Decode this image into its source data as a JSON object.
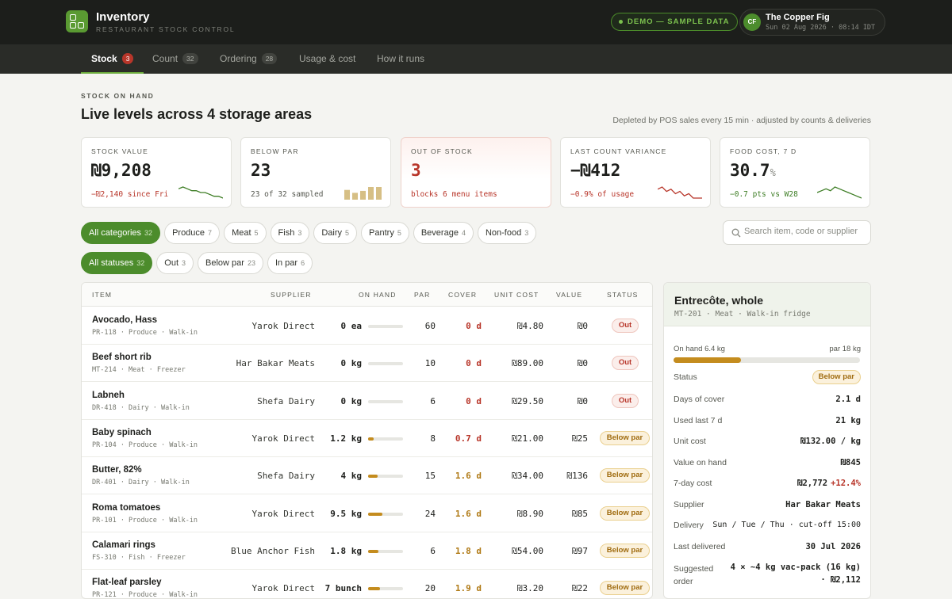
{
  "app": {
    "title": "Inventory",
    "subtitle": "RESTAURANT STOCK CONTROL",
    "demo_label": "DEMO — SAMPLE DATA",
    "venue_initials": "CF",
    "venue_name": "The Copper Fig",
    "venue_time": "Sun 02 Aug 2026 · 08:14 IDT",
    "logo_icon": "grid-logo-icon"
  },
  "tabs": [
    {
      "label": "Stock",
      "count": "3",
      "active": true
    },
    {
      "label": "Count",
      "count": "32"
    },
    {
      "label": "Ordering",
      "count": "28"
    },
    {
      "label": "Usage & cost",
      "count": ""
    },
    {
      "label": "How it runs",
      "count": ""
    }
  ],
  "header": {
    "eyebrow": "STOCK ON HAND",
    "title": "Live levels across 4 storage areas",
    "note": "Depleted by POS sales every 15 min · adjusted by counts & deliveries"
  },
  "kpis": [
    {
      "label": "STOCK VALUE",
      "value": "₪9,208",
      "unit": "",
      "note": "−₪2,140 since Fri",
      "note_color": "#b8362a",
      "spark": "line",
      "spark_color": "#3d7d24",
      "spark_values": [
        9,
        10,
        9,
        8,
        8,
        7,
        7,
        6,
        5,
        5,
        4
      ]
    },
    {
      "label": "BELOW PAR",
      "value": "23",
      "unit": "",
      "note": "23 of 32 sampled",
      "note_color": "#55574f",
      "spark": "bars",
      "spark_color": "#d6bf85",
      "spark_values": [
        10,
        7,
        9,
        13,
        13
      ]
    },
    {
      "label": "OUT OF STOCK",
      "value": "3",
      "unit": "",
      "note": "blocks 6 menu items",
      "note_color": "#b8362a",
      "value_color": "#b8362a",
      "spark": "none",
      "alert": true
    },
    {
      "label": "LAST COUNT VARIANCE",
      "value": "−₪412",
      "unit": "",
      "note": "−0.9% of usage",
      "note_color": "#b8362a",
      "spark": "line",
      "spark_color": "#b8362a",
      "spark_values": [
        8,
        9,
        7,
        8,
        6,
        7,
        5,
        6,
        4,
        4,
        4
      ]
    },
    {
      "label": "FOOD COST, 7 D",
      "value": "30.7",
      "unit": "%",
      "note": "−0.7 pts vs W28",
      "note_color": "#3d7d24",
      "spark": "line",
      "spark_color": "#3d7d24",
      "spark_values": [
        6,
        7,
        8,
        7,
        9,
        8,
        7,
        6,
        5,
        4,
        3
      ]
    }
  ],
  "category_filters": [
    {
      "label": "All categories",
      "count": "32",
      "active": true
    },
    {
      "label": "Produce",
      "count": "7"
    },
    {
      "label": "Meat",
      "count": "5"
    },
    {
      "label": "Fish",
      "count": "3"
    },
    {
      "label": "Dairy",
      "count": "5"
    },
    {
      "label": "Pantry",
      "count": "5"
    },
    {
      "label": "Beverage",
      "count": "4"
    },
    {
      "label": "Non-food",
      "count": "3"
    }
  ],
  "status_filters": [
    {
      "label": "All statuses",
      "count": "32",
      "active": true
    },
    {
      "label": "Out",
      "count": "3"
    },
    {
      "label": "Below par",
      "count": "23"
    },
    {
      "label": "In par",
      "count": "6"
    }
  ],
  "search": {
    "placeholder": "Search item, code or supplier",
    "icon": "search-icon"
  },
  "table": {
    "columns": [
      "ITEM",
      "SUPPLIER",
      "ON HAND",
      "PAR",
      "COVER",
      "UNIT COST",
      "VALUE",
      "STATUS"
    ],
    "rows": [
      {
        "name": "Avocado, Hass",
        "meta": "PR-118 · Produce · Walk-in",
        "supplier": "Yarok Direct",
        "on_hand": "0 ea",
        "level": 0,
        "par": "60",
        "cover": "0 d",
        "cover_tone": "red",
        "unit_cost": "₪4.80",
        "value": "₪0",
        "status": "Out",
        "status_tone": "out"
      },
      {
        "name": "Beef short rib",
        "meta": "MT-214 · Meat · Freezer",
        "supplier": "Har Bakar Meats",
        "on_hand": "0 kg",
        "level": 0,
        "par": "10",
        "cover": "0 d",
        "cover_tone": "red",
        "unit_cost": "₪89.00",
        "value": "₪0",
        "status": "Out",
        "status_tone": "out"
      },
      {
        "name": "Labneh",
        "meta": "DR-418 · Dairy · Walk-in",
        "supplier": "Shefa Dairy",
        "on_hand": "0 kg",
        "level": 0,
        "par": "6",
        "cover": "0 d",
        "cover_tone": "red",
        "unit_cost": "₪29.50",
        "value": "₪0",
        "status": "Out",
        "status_tone": "out"
      },
      {
        "name": "Baby spinach",
        "meta": "PR-104 · Produce · Walk-in",
        "supplier": "Yarok Direct",
        "on_hand": "1.2 kg",
        "level": 0.15,
        "par": "8",
        "cover": "0.7 d",
        "cover_tone": "red",
        "unit_cost": "₪21.00",
        "value": "₪25",
        "status": "Below par",
        "status_tone": "below"
      },
      {
        "name": "Butter, 82%",
        "meta": "DR-401 · Dairy · Walk-in",
        "supplier": "Shefa Dairy",
        "on_hand": "4 kg",
        "level": 0.27,
        "par": "15",
        "cover": "1.6 d",
        "cover_tone": "amb",
        "unit_cost": "₪34.00",
        "value": "₪136",
        "status": "Below par",
        "status_tone": "below"
      },
      {
        "name": "Roma tomatoes",
        "meta": "PR-101 · Produce · Walk-in",
        "supplier": "Yarok Direct",
        "on_hand": "9.5 kg",
        "level": 0.4,
        "par": "24",
        "cover": "1.6 d",
        "cover_tone": "amb",
        "unit_cost": "₪8.90",
        "value": "₪85",
        "status": "Below par",
        "status_tone": "below"
      },
      {
        "name": "Calamari rings",
        "meta": "FS-310 · Fish · Freezer",
        "supplier": "Blue Anchor Fish",
        "on_hand": "1.8 kg",
        "level": 0.3,
        "par": "6",
        "cover": "1.8 d",
        "cover_tone": "amb",
        "unit_cost": "₪54.00",
        "value": "₪97",
        "status": "Below par",
        "status_tone": "below"
      },
      {
        "name": "Flat-leaf parsley",
        "meta": "PR-121 · Produce · Walk-in",
        "supplier": "Yarok Direct",
        "on_hand": "7 bunch",
        "level": 0.35,
        "par": "20",
        "cover": "1.9 d",
        "cover_tone": "amb",
        "unit_cost": "₪3.20",
        "value": "₪22",
        "status": "Below par",
        "status_tone": "below"
      }
    ]
  },
  "detail": {
    "title": "Entrecôte, whole",
    "subtitle": "MT-201 · Meat · Walk-in fridge",
    "on_hand_label": "On hand 6.4 kg",
    "par_label": "par 18 kg",
    "level": 0.36,
    "status_label": "Status",
    "status_value": "Below par",
    "fields": [
      {
        "label": "Days of cover",
        "value": "2.1 d"
      },
      {
        "label": "Used last 7 d",
        "value": "21 kg"
      },
      {
        "label": "Unit cost",
        "value": "₪132.00 / kg"
      },
      {
        "label": "Value on hand",
        "value": "₪845"
      },
      {
        "label": "7-day cost",
        "value": "₪2,772",
        "extra": "+12.4%"
      },
      {
        "label": "Supplier",
        "value": "Har Bakar Meats"
      },
      {
        "label": "Delivery",
        "value": "Sun / Tue / Thu · cut-off 15:00"
      },
      {
        "label": "Last delivered",
        "value": "30 Jul 2026"
      }
    ],
    "suggested_label": "Suggested order",
    "suggested_line1": "4 × ~4 kg vac-pack (16 kg)",
    "suggested_line2": "· ₪2,112"
  }
}
